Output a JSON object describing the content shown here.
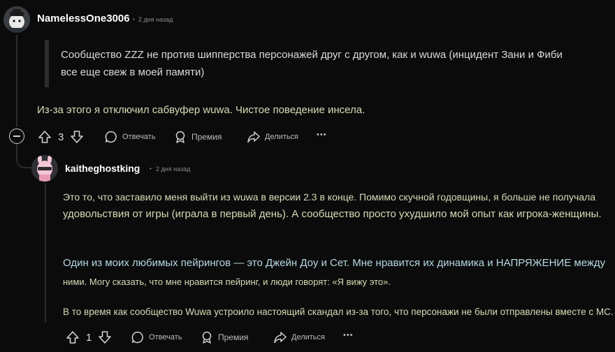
{
  "comment1": {
    "username": "NamelessOne3006",
    "time": "2 дня назад",
    "quote_lines": [
      "Сообщество ZZZ не против шипперства персонажей друг с другом, как и wuwa (инцидент Зани и Фиби",
      "все еще свеж в моей памяти)"
    ],
    "body": "Из-за этого я отключил сабвуфер wuwa. Чистое поведение инсела.",
    "votes": "3",
    "actions": {
      "reply": "Отвечать",
      "award": "Премия",
      "share": "Делиться",
      "more": "•••"
    }
  },
  "comment2": {
    "username": "kaitheghostking",
    "time": "2 дня назад",
    "para1": [
      "Это то, что заставило меня выйти из wuwa в версии 2.3 в конце. Помимо скучной годовщины, я больше не получала",
      "удовольствия от игры (играла в первый день). А сообщество просто ухудшило мой опыт как игрока-женщины."
    ],
    "para2": [
      "Один из моих любимых пейрингов — это Джейн Доу и Сет. Мне нравится их динамика и НАПРЯЖЕНИЕ между",
      "ними. Могу сказать, что мне нравится пейринг, и люди говорят: «Я вижу это»."
    ],
    "para3": "В то время как сообщество Wuwa устроило настоящий скандал из-за того, что персонажи не были отправлены вместе с МС.",
    "votes": "1",
    "actions": {
      "reply": "Отвечать",
      "award": "Премия",
      "share": "Делиться",
      "more": "•••"
    }
  },
  "colors": {
    "background": "#0b0b0c",
    "text": "#d7dadc",
    "meta": "#8a8a8a"
  }
}
